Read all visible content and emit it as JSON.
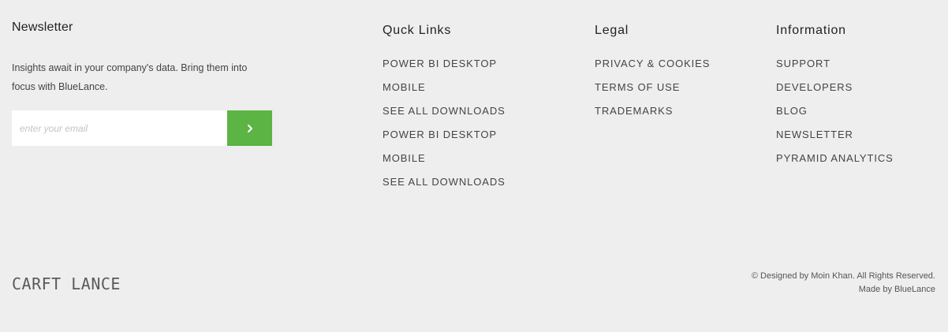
{
  "newsletter": {
    "title": "Newsletter",
    "description": "Insights await in your company's data. Bring them into focus with BlueLance.",
    "email_placeholder": "enter your email",
    "submit_icon": "chevron-right-icon",
    "accent_color": "#5bb443"
  },
  "quick_links": {
    "title": "Quck Links",
    "items": [
      "POWER BI DESKTOP",
      "MOBILE",
      "SEE ALL DOWNLOADS",
      "POWER BI DESKTOP",
      "MOBILE",
      "SEE ALL DOWNLOADS"
    ]
  },
  "legal": {
    "title": "Legal",
    "items": [
      "PRIVACY & COOKIES",
      "TERMS OF USE",
      "TRADEMARKS"
    ]
  },
  "information": {
    "title": "Information",
    "items": [
      "SUPPORT",
      "DEVELOPERS",
      "BLOG",
      "NEWSLETTER",
      "PYRAMID ANALYTICS"
    ]
  },
  "bottom": {
    "logo": "CARFT LANCE",
    "copyright": "© Designed by Moin Khan. All Rights Reserved.",
    "made_by": "Made by BlueLance"
  }
}
